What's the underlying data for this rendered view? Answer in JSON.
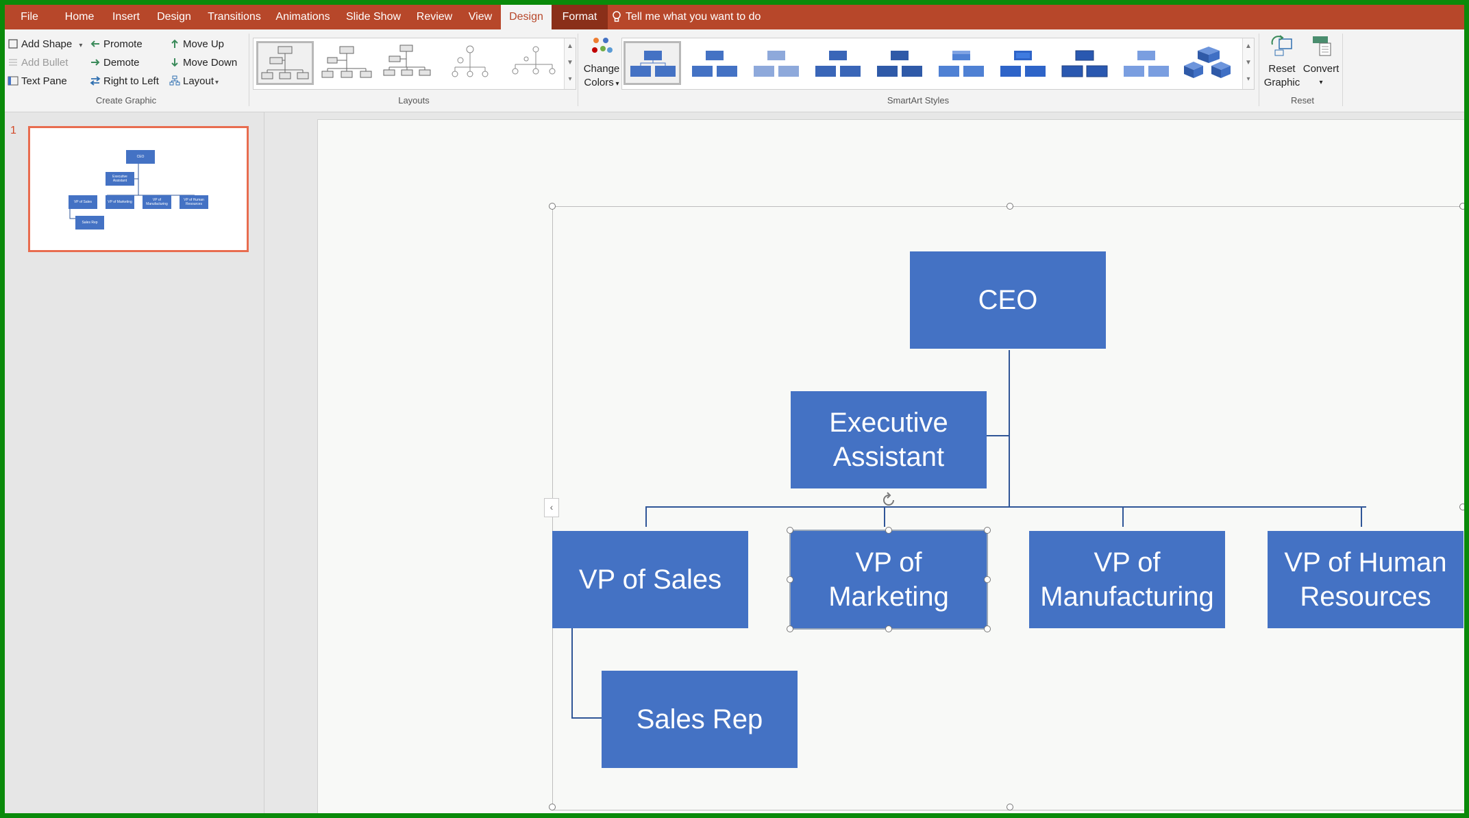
{
  "menu": {
    "tabs": [
      {
        "label": "File"
      },
      {
        "label": "Home"
      },
      {
        "label": "Insert"
      },
      {
        "label": "Design"
      },
      {
        "label": "Transitions"
      },
      {
        "label": "Animations"
      },
      {
        "label": "Slide Show"
      },
      {
        "label": "Review"
      },
      {
        "label": "View"
      },
      {
        "label": "Design"
      },
      {
        "label": "Format"
      }
    ],
    "tell_me": "Tell me what you want to do",
    "accent_color": "#b7472a"
  },
  "ribbon": {
    "create_graphic": {
      "label": "Create Graphic",
      "add_shape": "Add Shape",
      "add_bullet": "Add Bullet",
      "text_pane": "Text Pane",
      "promote": "Promote",
      "demote": "Demote",
      "right_to_left": "Right to Left",
      "move_up": "Move Up",
      "move_down": "Move Down",
      "layout": "Layout"
    },
    "layouts": {
      "label": "Layouts"
    },
    "smartart_styles": {
      "label": "SmartArt Styles",
      "change_colors": [
        "Change",
        "Colors"
      ]
    },
    "reset": {
      "label": "Reset",
      "reset_graphic": [
        "Reset",
        "Graphic"
      ],
      "convert": "Convert"
    }
  },
  "thumbnails": {
    "slide_number": "1",
    "nodes": {
      "ceo": "CEO",
      "exec": "Executive Assistant",
      "vp_sales": "VP of Sales",
      "vp_marketing": "VP of Marketing",
      "vp_manufacturing": "VP of Manufacturing",
      "vp_hr": "VP of Human Resources",
      "sales_rep": "Sales Rep"
    }
  },
  "org_chart": {
    "fill_color": "#4472c4",
    "ceo": "CEO",
    "exec_line1": "Executive",
    "exec_line2": "Assistant",
    "vp_sales": "VP of Sales",
    "vp_marketing_line1": "VP of",
    "vp_marketing_line2": "Marketing",
    "vp_manufacturing_line1": "VP of",
    "vp_manufacturing_line2": "Manufacturing",
    "vp_hr_line1": "VP of Human",
    "vp_hr_line2": "Resources",
    "sales_rep": "Sales Rep"
  }
}
